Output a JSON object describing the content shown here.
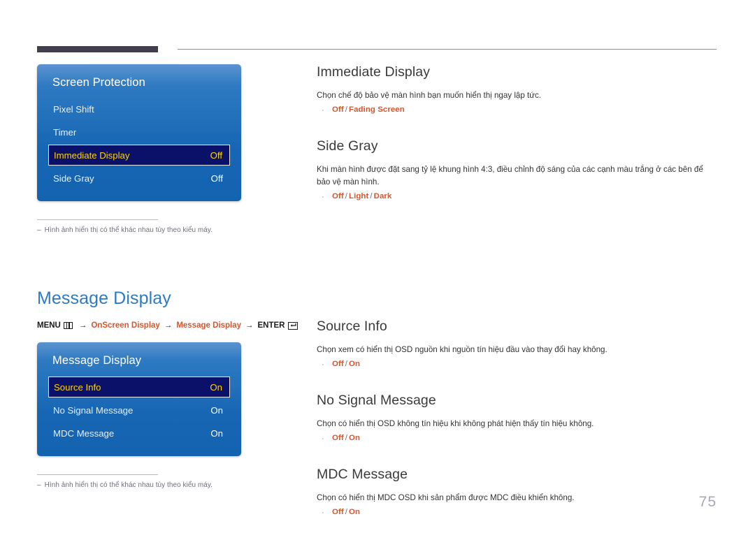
{
  "page": {
    "number": "75",
    "footnote": "Hình ảnh hiển thị có thể khác nhau tùy theo kiểu máy.",
    "footnote_dash": "‒"
  },
  "colors": {
    "heading_blue": "#2e7ac4",
    "option_orange": "#d9542b",
    "osd_blue": "#1766b4",
    "osd_highlight_bg": "#0b1068",
    "osd_highlight_text": "#ffd400",
    "header_bar": "#423e4c"
  },
  "top_section": {
    "osd": {
      "title": "Screen Protection",
      "rows": [
        {
          "label": "Pixel Shift",
          "value": "",
          "selected": false
        },
        {
          "label": "Timer",
          "value": "",
          "selected": false
        },
        {
          "label": "Immediate Display",
          "value": "Off",
          "selected": true
        },
        {
          "label": "Side Gray",
          "value": "Off",
          "selected": false
        }
      ]
    },
    "sections": [
      {
        "heading": "Immediate Display",
        "description": "Chọn chế độ bảo vệ màn hình bạn muốn hiển thị ngay lập tức.",
        "bullet": "·",
        "options": [
          "Off",
          "Fading Screen"
        ]
      },
      {
        "heading": "Side Gray",
        "description": "Khi màn hình được đặt sang tỷ lệ khung hình 4:3, điều chỉnh độ sáng của các cạnh màu trắng ở các bên để bảo vệ màn hình.",
        "bullet": "·",
        "options": [
          "Off",
          "Light",
          "Dark"
        ]
      }
    ]
  },
  "bottom_section": {
    "title": "Message Display",
    "breadcrumb": {
      "menu_label": "MENU",
      "menu_icon": "menu-icon",
      "arrow": "→",
      "path1": "OnScreen Display",
      "path2": "Message Display",
      "enter_label": "ENTER",
      "enter_icon": "enter-icon"
    },
    "osd": {
      "title": "Message Display",
      "rows": [
        {
          "label": "Source Info",
          "value": "On",
          "selected": true
        },
        {
          "label": "No Signal Message",
          "value": "On",
          "selected": false
        },
        {
          "label": "MDC Message",
          "value": "On",
          "selected": false
        }
      ]
    },
    "sections": [
      {
        "heading": "Source Info",
        "description": "Chọn xem có hiển thị OSD nguồn khi nguồn tín hiệu đầu vào thay đổi hay không.",
        "bullet": "·",
        "options": [
          "Off",
          "On"
        ]
      },
      {
        "heading": "No Signal Message",
        "description": "Chọn có hiển thị OSD không tín hiệu khi không phát hiện thấy tín hiệu không.",
        "bullet": "·",
        "options": [
          "Off",
          "On"
        ]
      },
      {
        "heading": "MDC Message",
        "description": "Chọn có hiển thị MDC OSD khi sản phẩm được MDC điều khiển không.",
        "bullet": "·",
        "options": [
          "Off",
          "On"
        ]
      }
    ]
  }
}
